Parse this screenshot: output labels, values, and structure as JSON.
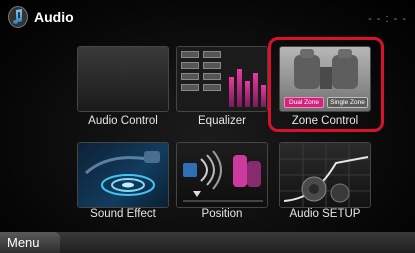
{
  "header": {
    "title": "Audio",
    "clock": "- - : - -",
    "icon": "music-note-icon"
  },
  "tiles": [
    {
      "id": "audio-control",
      "label": "Audio Control"
    },
    {
      "id": "equalizer",
      "label": "Equalizer"
    },
    {
      "id": "zone-control",
      "label": "Zone Control",
      "selected": true,
      "buttons": {
        "dual": "Dual Zone",
        "single": "Single Zone"
      }
    },
    {
      "id": "sound-effect",
      "label": "Sound Effect"
    },
    {
      "id": "position",
      "label": "Position"
    },
    {
      "id": "audio-setup",
      "label": "Audio SETUP"
    }
  ],
  "menu": {
    "label": "Menu"
  },
  "colors": {
    "highlight": "#d8122d",
    "accent": "#e83aa0"
  }
}
